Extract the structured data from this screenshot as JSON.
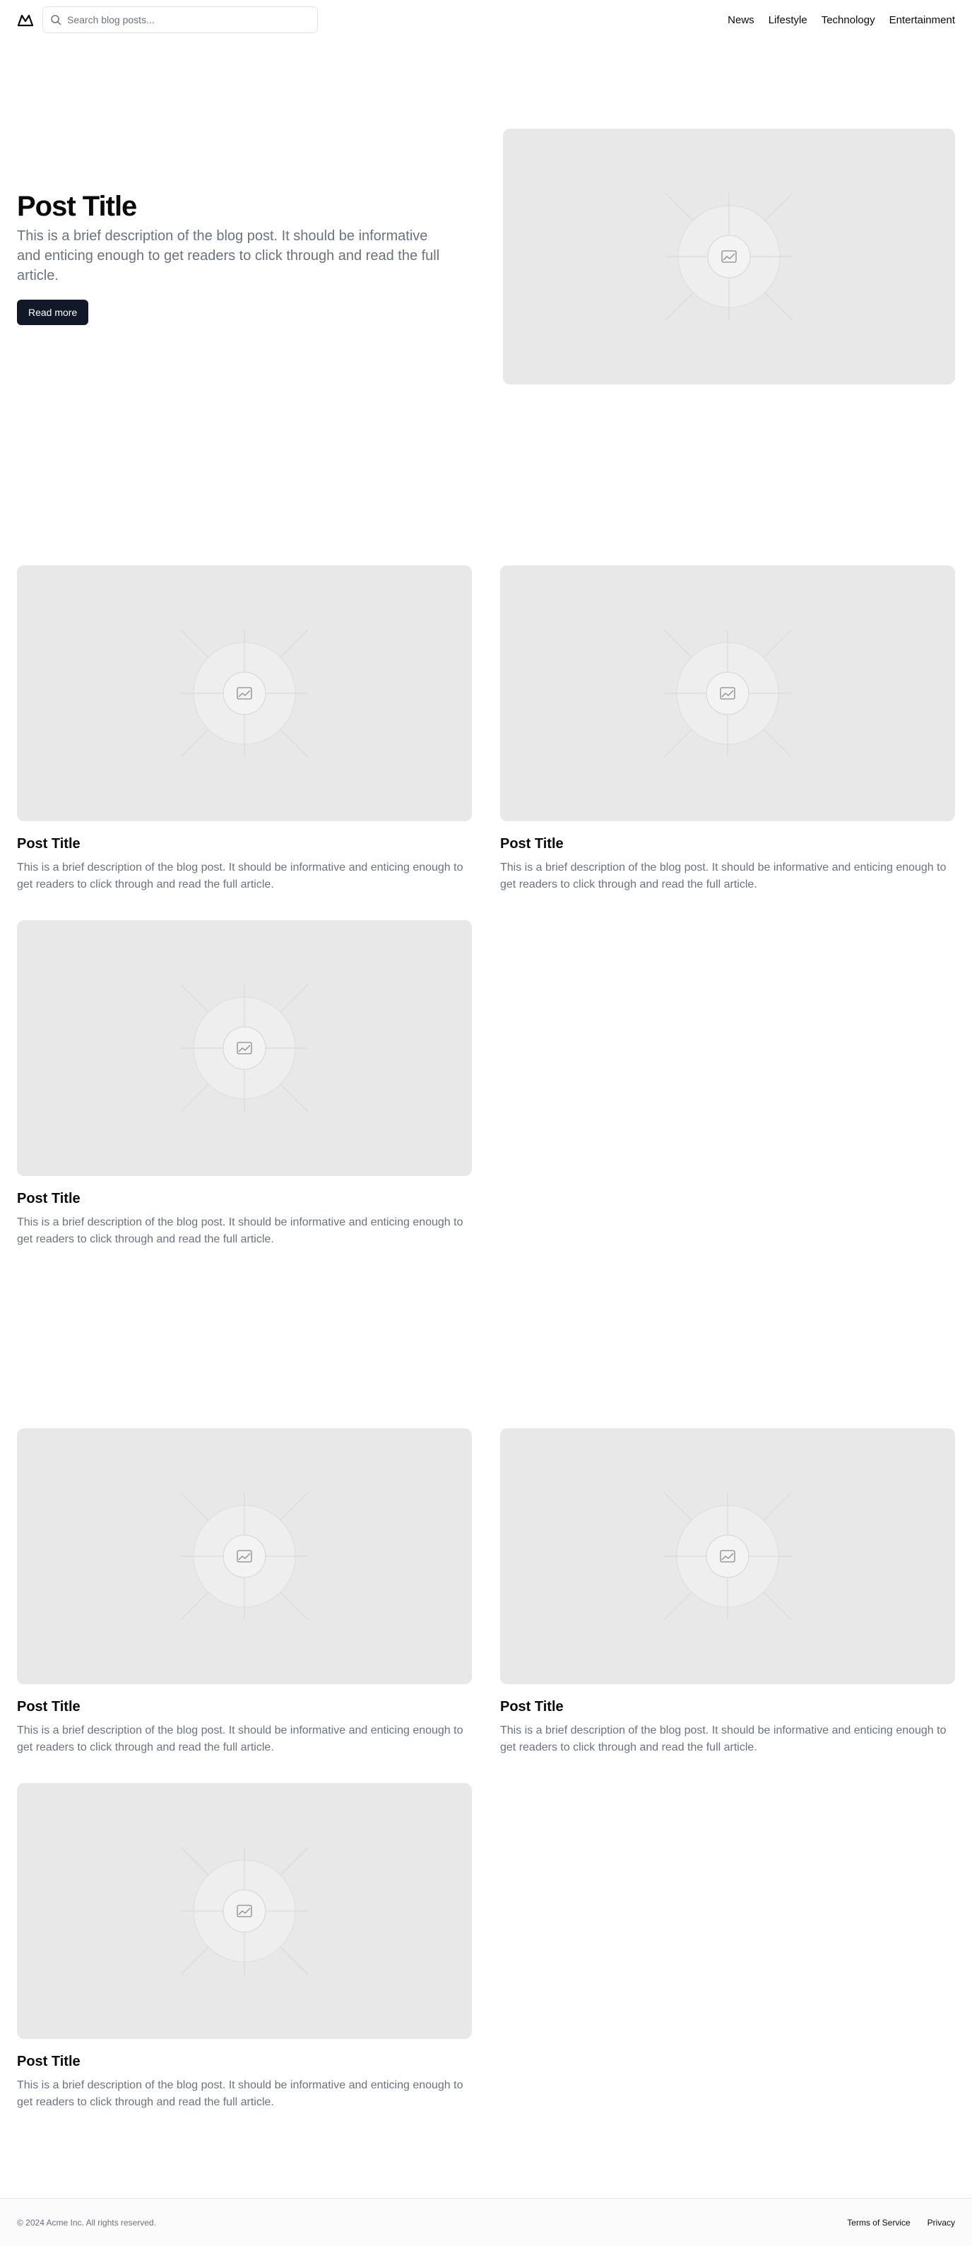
{
  "header": {
    "logo_icon": "mountain-icon",
    "search_icon": "search-icon",
    "search_placeholder": "Search blog posts...",
    "search_value": "",
    "nav": [
      {
        "label": "News"
      },
      {
        "label": "Lifestyle"
      },
      {
        "label": "Technology"
      },
      {
        "label": "Entertainment"
      }
    ]
  },
  "hero": {
    "title": "Post Title",
    "description": "This is a brief description of the blog post. It should be informative and enticing enough to get readers to click through and read the full article.",
    "button_label": "Read more",
    "image_icon": "image-placeholder-icon"
  },
  "posts": [
    {
      "title": "Post Title",
      "description": "This is a brief description of the blog post. It should be informative and enticing enough to get readers to click through and read the full article."
    },
    {
      "title": "Post Title",
      "description": "This is a brief description of the blog post. It should be informative and enticing enough to get readers to click through and read the full article."
    },
    {
      "title": "Post Title",
      "description": "This is a brief description of the blog post. It should be informative and enticing enough to get readers to click through and read the full article."
    },
    {
      "title": "Post Title",
      "description": "This is a brief description of the blog post. It should be informative and enticing enough to get readers to click through and read the full article."
    },
    {
      "title": "Post Title",
      "description": "This is a brief description of the blog post. It should be informative and enticing enough to get readers to click through and read the full article."
    },
    {
      "title": "Post Title",
      "description": "This is a brief description of the blog post. It should be informative and enticing enough to get readers to click through and read the full article."
    }
  ],
  "footer": {
    "copyright": "© 2024 Acme Inc. All rights reserved.",
    "links": [
      {
        "label": "Terms of Service"
      },
      {
        "label": "Privacy"
      }
    ]
  },
  "colors": {
    "primary_button": "#111827",
    "placeholder_bg": "#e8e8e8",
    "muted_text": "#6b7280"
  }
}
